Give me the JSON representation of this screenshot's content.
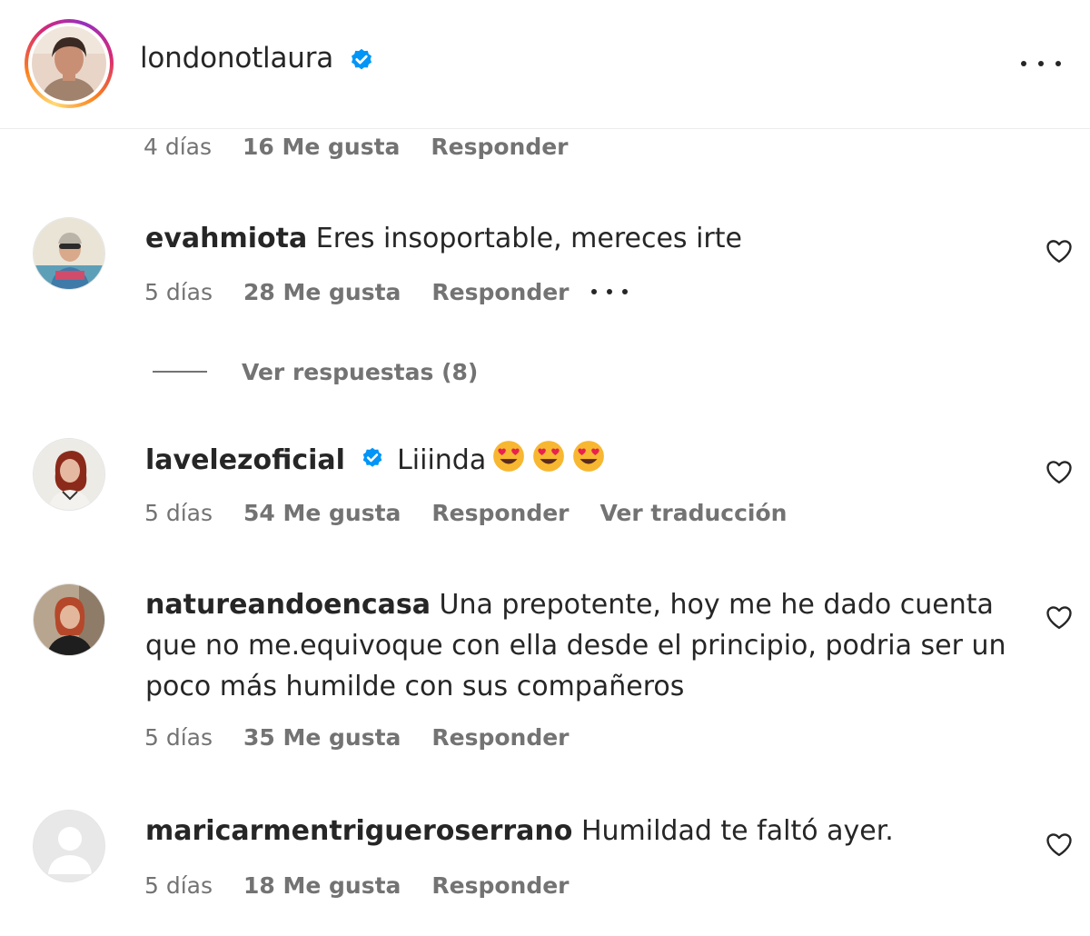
{
  "header": {
    "username": "londonotlaura",
    "verified": true,
    "more_icon": "more-horizontal-icon"
  },
  "top_meta": {
    "time": "4 días",
    "likes": "16 Me gusta",
    "reply": "Responder"
  },
  "comments": [
    {
      "username": "evahmiota",
      "text": "Eres insoportable, mereces irte",
      "time": "5 días",
      "likes": "28 Me gusta",
      "reply": "Responder",
      "view_replies": "Ver respuestas (8)"
    },
    {
      "username": "lavelezoficial",
      "verified": true,
      "text": "Liiinda",
      "emoji": "heart-eyes-emoji",
      "time": "5 días",
      "likes": "54 Me gusta",
      "reply": "Responder",
      "translate": "Ver traducción"
    },
    {
      "username": "natureandoencasa",
      "text_line1": "Una prepotente, hoy me he dado cuenta",
      "text_line2": "que no me.equivoque con ella desde el principio, podria ser un",
      "text_line3": "poco más humilde con sus compañeros",
      "time": "5 días",
      "likes": "35 Me gusta",
      "reply": "Responder"
    },
    {
      "username": "maricarmentrigueroserrano",
      "text": "Humildad te faltó ayer.",
      "time": "5 días",
      "likes": "18 Me gusta",
      "reply": "Responder"
    }
  ],
  "colors": {
    "primary_text": "#262626",
    "secondary_text": "#737373",
    "verified_blue": "#0095f6"
  }
}
